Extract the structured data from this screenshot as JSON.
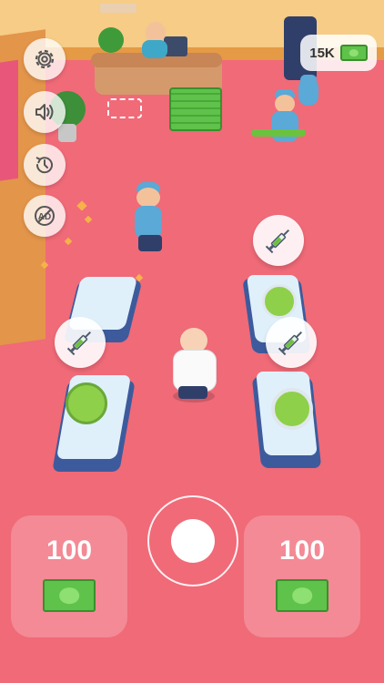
{
  "hud": {
    "money": "15K",
    "buttons": [
      {
        "name": "settings-button",
        "icon": "gear-icon"
      },
      {
        "name": "sound-button",
        "icon": "speaker-icon"
      },
      {
        "name": "history-button",
        "icon": "history-icon"
      },
      {
        "name": "no-ads-button",
        "icon": "no-ads-icon",
        "label": "AD"
      }
    ]
  },
  "panels": {
    "left_price": "100",
    "right_price": "100"
  },
  "colors": {
    "floor": "#f06a78",
    "wall": "#f5c77a",
    "money_green": "#5fc24a",
    "scrub_blue": "#5aa9d6",
    "bed_frame": "#3d5b9c"
  }
}
